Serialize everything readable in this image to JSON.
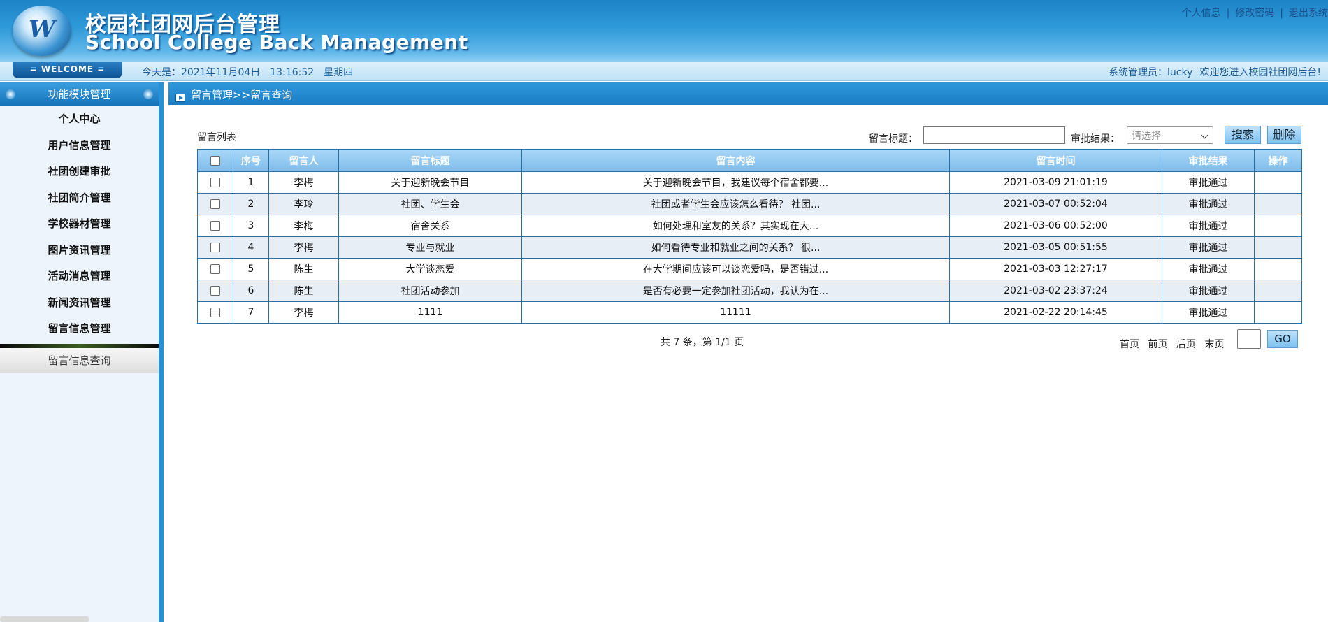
{
  "app": {
    "title_cn": "校园社团网后台管理",
    "title_en": "School College Back Management",
    "logo_letter": "W"
  },
  "top_links": [
    {
      "label": "个人信息"
    },
    {
      "label": "修改密码"
    },
    {
      "label": "退出系统"
    }
  ],
  "top_link_sep": "|",
  "infobar": {
    "welcome": "= WELCOME =",
    "date": "今天是：2021年11月04日",
    "time": "13:16:52",
    "weekday": "星期四",
    "admin": "系统管理员：lucky",
    "greeting": "欢迎您进入校园社团网后台!"
  },
  "sidebar": {
    "header": "功能模块管理",
    "items": [
      {
        "label": "个人中心"
      },
      {
        "label": "用户信息管理"
      },
      {
        "label": "社团创建审批"
      },
      {
        "label": "社团简介管理"
      },
      {
        "label": "学校器材管理"
      },
      {
        "label": "图片资讯管理"
      },
      {
        "label": "活动消息管理"
      },
      {
        "label": "新闻资讯管理"
      },
      {
        "label": "留言信息管理"
      }
    ],
    "sub_item": "留言信息查询"
  },
  "breadcrumb": "留言管理>>留言查询",
  "list": {
    "title": "留言列表",
    "search_title_label": "留言标题：",
    "search_title_value": "",
    "approval_label": "审批结果：",
    "approval_select": "请选择",
    "search_button": "搜索",
    "delete_button": "删除"
  },
  "table": {
    "headers": [
      "序号",
      "留言人",
      "留言标题",
      "留言内容",
      "留言时间",
      "审批结果",
      "操作"
    ],
    "rows": [
      {
        "no": "1",
        "author": "李梅",
        "title": "关于迎新晚会节目",
        "content": "关于迎新晚会节目，我建议每个宿舍都要...",
        "time": "2021-03-09 21:01:19",
        "result": "审批通过",
        "op": ""
      },
      {
        "no": "2",
        "author": "李玲",
        "title": "社团、学生会",
        "content": "社团或者学生会应该怎么看待？ 社团...",
        "time": "2021-03-07 00:52:04",
        "result": "审批通过",
        "op": ""
      },
      {
        "no": "3",
        "author": "李梅",
        "title": "宿舍关系",
        "content": "如何处理和室友的关系？其实现在大...",
        "time": "2021-03-06 00:52:00",
        "result": "审批通过",
        "op": ""
      },
      {
        "no": "4",
        "author": "李梅",
        "title": "专业与就业",
        "content": "如何看待专业和就业之间的关系？ 很...",
        "time": "2021-03-05 00:51:55",
        "result": "审批通过",
        "op": ""
      },
      {
        "no": "5",
        "author": "陈生",
        "title": "大学谈恋爱",
        "content": "在大学期间应该可以谈恋爱吗，是否错过...",
        "time": "2021-03-03 12:27:17",
        "result": "审批通过",
        "op": ""
      },
      {
        "no": "6",
        "author": "陈生",
        "title": "社团活动参加",
        "content": "是否有必要一定参加社团活动，我认为在...",
        "time": "2021-03-02 23:37:24",
        "result": "审批通过",
        "op": ""
      },
      {
        "no": "7",
        "author": "李梅",
        "title": "1111",
        "content": "11111",
        "time": "2021-02-22 20:14:45",
        "result": "审批通过",
        "op": ""
      }
    ]
  },
  "pagination": {
    "summary": "共 7 条，第 1/1 页",
    "first": "首页",
    "prev": "前页",
    "next": "后页",
    "last": "末页",
    "page_value": "",
    "go": "GO"
  }
}
